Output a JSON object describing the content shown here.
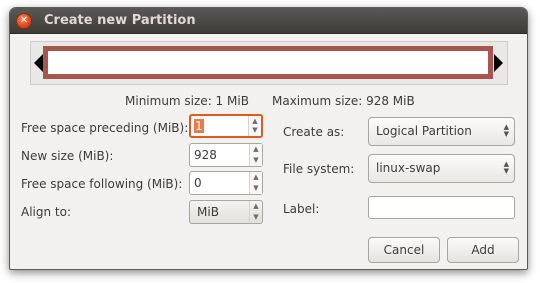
{
  "window": {
    "title": "Create new Partition",
    "close_glyph": "✕"
  },
  "graphic": {
    "min_size": "Minimum size: 1 MiB",
    "max_size": "Maximum size: 928 MiB"
  },
  "left_form": {
    "free_preceding_label": "Free space preceding (MiB):",
    "free_preceding_value": "1",
    "new_size_label": "New size (MiB):",
    "new_size_value": "928",
    "free_following_label": "Free space following (MiB):",
    "free_following_value": "0",
    "align_label": "Align to:",
    "align_value": "MiB"
  },
  "right_form": {
    "create_as_label": "Create as:",
    "create_as_value": "Logical Partition",
    "file_system_label": "File system:",
    "file_system_value": "linux-swap",
    "label_label": "Label:",
    "label_value": ""
  },
  "buttons": {
    "cancel": "Cancel",
    "add": "Add"
  },
  "icons": {
    "spin_up": "▲",
    "spin_down": "▼"
  }
}
